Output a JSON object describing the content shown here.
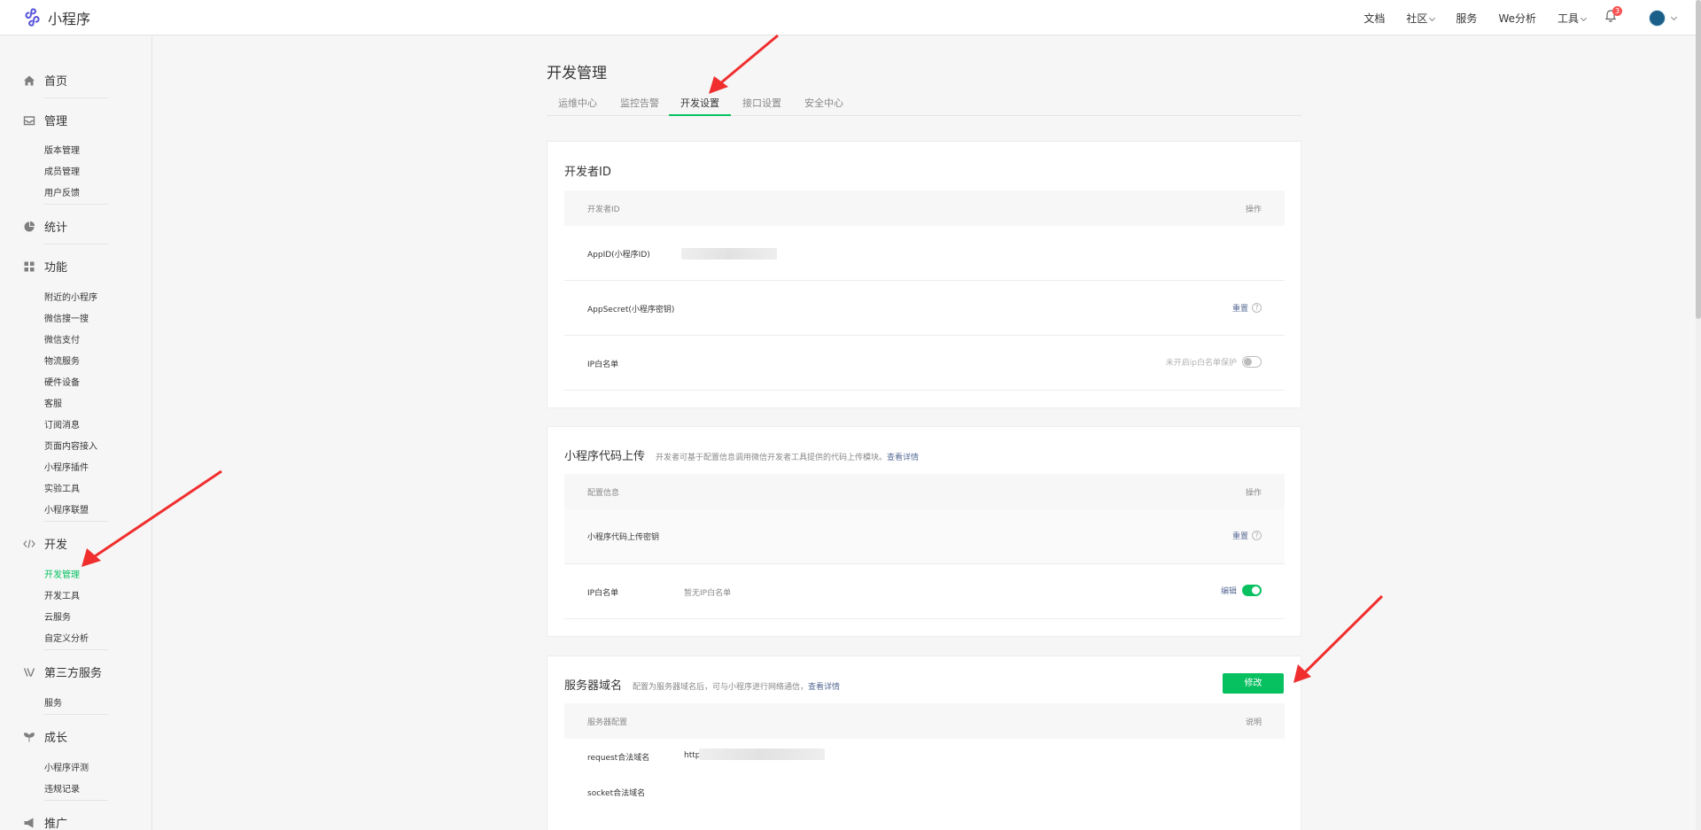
{
  "header": {
    "app_name": "小程序",
    "nav": [
      {
        "label": "文档",
        "caret": false
      },
      {
        "label": "社区",
        "caret": true
      },
      {
        "label": "服务",
        "caret": false
      },
      {
        "label": "We分析",
        "caret": false
      },
      {
        "label": "工具",
        "caret": true
      }
    ],
    "notification_count": "3",
    "icons": [
      "miniprogram-logo-icon",
      "bell-icon",
      "avatar"
    ]
  },
  "sidebar": {
    "home": "首页",
    "manage": {
      "title": "管理",
      "items": [
        "版本管理",
        "成员管理",
        "用户反馈"
      ]
    },
    "stats": "统计",
    "features": {
      "title": "功能",
      "items": [
        "附近的小程序",
        "微信搜一搜",
        "微信支付",
        "物流服务",
        "硬件设备",
        "客服",
        "订阅消息",
        "页面内容接入",
        "小程序插件",
        "实验工具",
        "小程序联盟"
      ]
    },
    "develop": {
      "title": "开发",
      "items": [
        "开发管理",
        "开发工具",
        "云服务",
        "自定义分析"
      ],
      "active": "开发管理"
    },
    "third_party": {
      "title": "第三方服务",
      "items": [
        "服务"
      ]
    },
    "growth": {
      "title": "成长",
      "items": [
        "小程序评测",
        "违规记录"
      ]
    },
    "promote": "推广"
  },
  "main": {
    "title": "开发管理",
    "tabs": [
      "运维中心",
      "监控告警",
      "开发设置",
      "接口设置",
      "安全中心"
    ],
    "active_tab": "开发设置",
    "developer_id": {
      "title": "开发者ID",
      "col_left": "开发者ID",
      "col_right": "操作",
      "appid_label": "AppID(小程序ID)",
      "appsecret_label": "AppSecret(小程序密钥)",
      "appsecret_action": "重置",
      "ip_label": "IP白名单",
      "ip_status": "未开启ip白名单保护"
    },
    "code_upload": {
      "title": "小程序代码上传",
      "desc": "开发者可基于配置信息调用微信开发者工具提供的代码上传模块。",
      "desc_link": "查看详情",
      "col_left": "配置信息",
      "col_right": "操作",
      "key_label": "小程序代码上传密钥",
      "key_action": "重置",
      "ip_label": "IP白名单",
      "ip_value": "暂无IP白名单",
      "ip_action": "编辑"
    },
    "server_domain": {
      "title": "服务器域名",
      "desc": "配置为服务器域名后，可与小程序进行网络通信，",
      "desc_link": "查看详情",
      "button": "修改",
      "col_left": "服务器配置",
      "col_right": "说明",
      "request_label": "request合法域名",
      "request_value": "http",
      "socket_label": "socket合法域名"
    }
  },
  "colors": {
    "accent": "#07c160",
    "link": "#576b95",
    "annotation_arrow": "#f02e2e"
  }
}
